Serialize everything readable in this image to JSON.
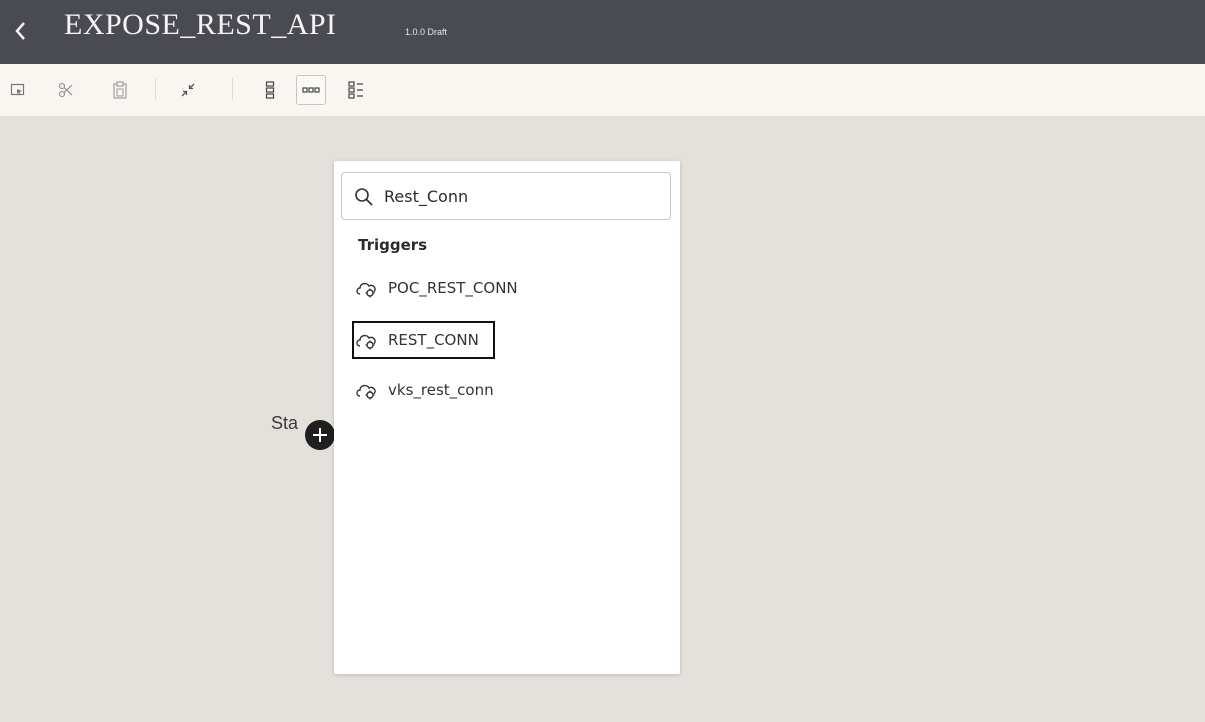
{
  "titlebar": {
    "back_icon": "chevron-left-icon",
    "title": "EXPOSE_REST_API",
    "version": "1.0.0 Draft"
  },
  "toolbar": {
    "buttons": [
      {
        "name": "select-icon"
      },
      {
        "name": "cut-icon"
      },
      {
        "name": "paste-icon"
      },
      {
        "name": "collapse-icon"
      },
      {
        "name": "vertical-layout-icon"
      },
      {
        "name": "horizontal-layout-icon",
        "active": true
      },
      {
        "name": "pseudo-layout-icon"
      }
    ]
  },
  "canvas": {
    "start_label": "Sta"
  },
  "popup": {
    "search": {
      "value": "Rest_Conn"
    },
    "section_heading": "Triggers",
    "items": [
      {
        "label": "POC_REST_CONN",
        "icon": "cloud-connection-icon"
      },
      {
        "label": "REST_CONN",
        "icon": "cloud-connection-icon",
        "highlighted": true
      },
      {
        "label": "vks_rest_conn",
        "icon": "cloud-connection-icon"
      }
    ]
  },
  "colors": {
    "titlebar_bg": "#4a4b52",
    "toolbar_bg": "#f9f6f2",
    "canvas_bg": "#e4e1dd",
    "popup_bg": "#ffffff",
    "highlight_border": "#111111"
  }
}
